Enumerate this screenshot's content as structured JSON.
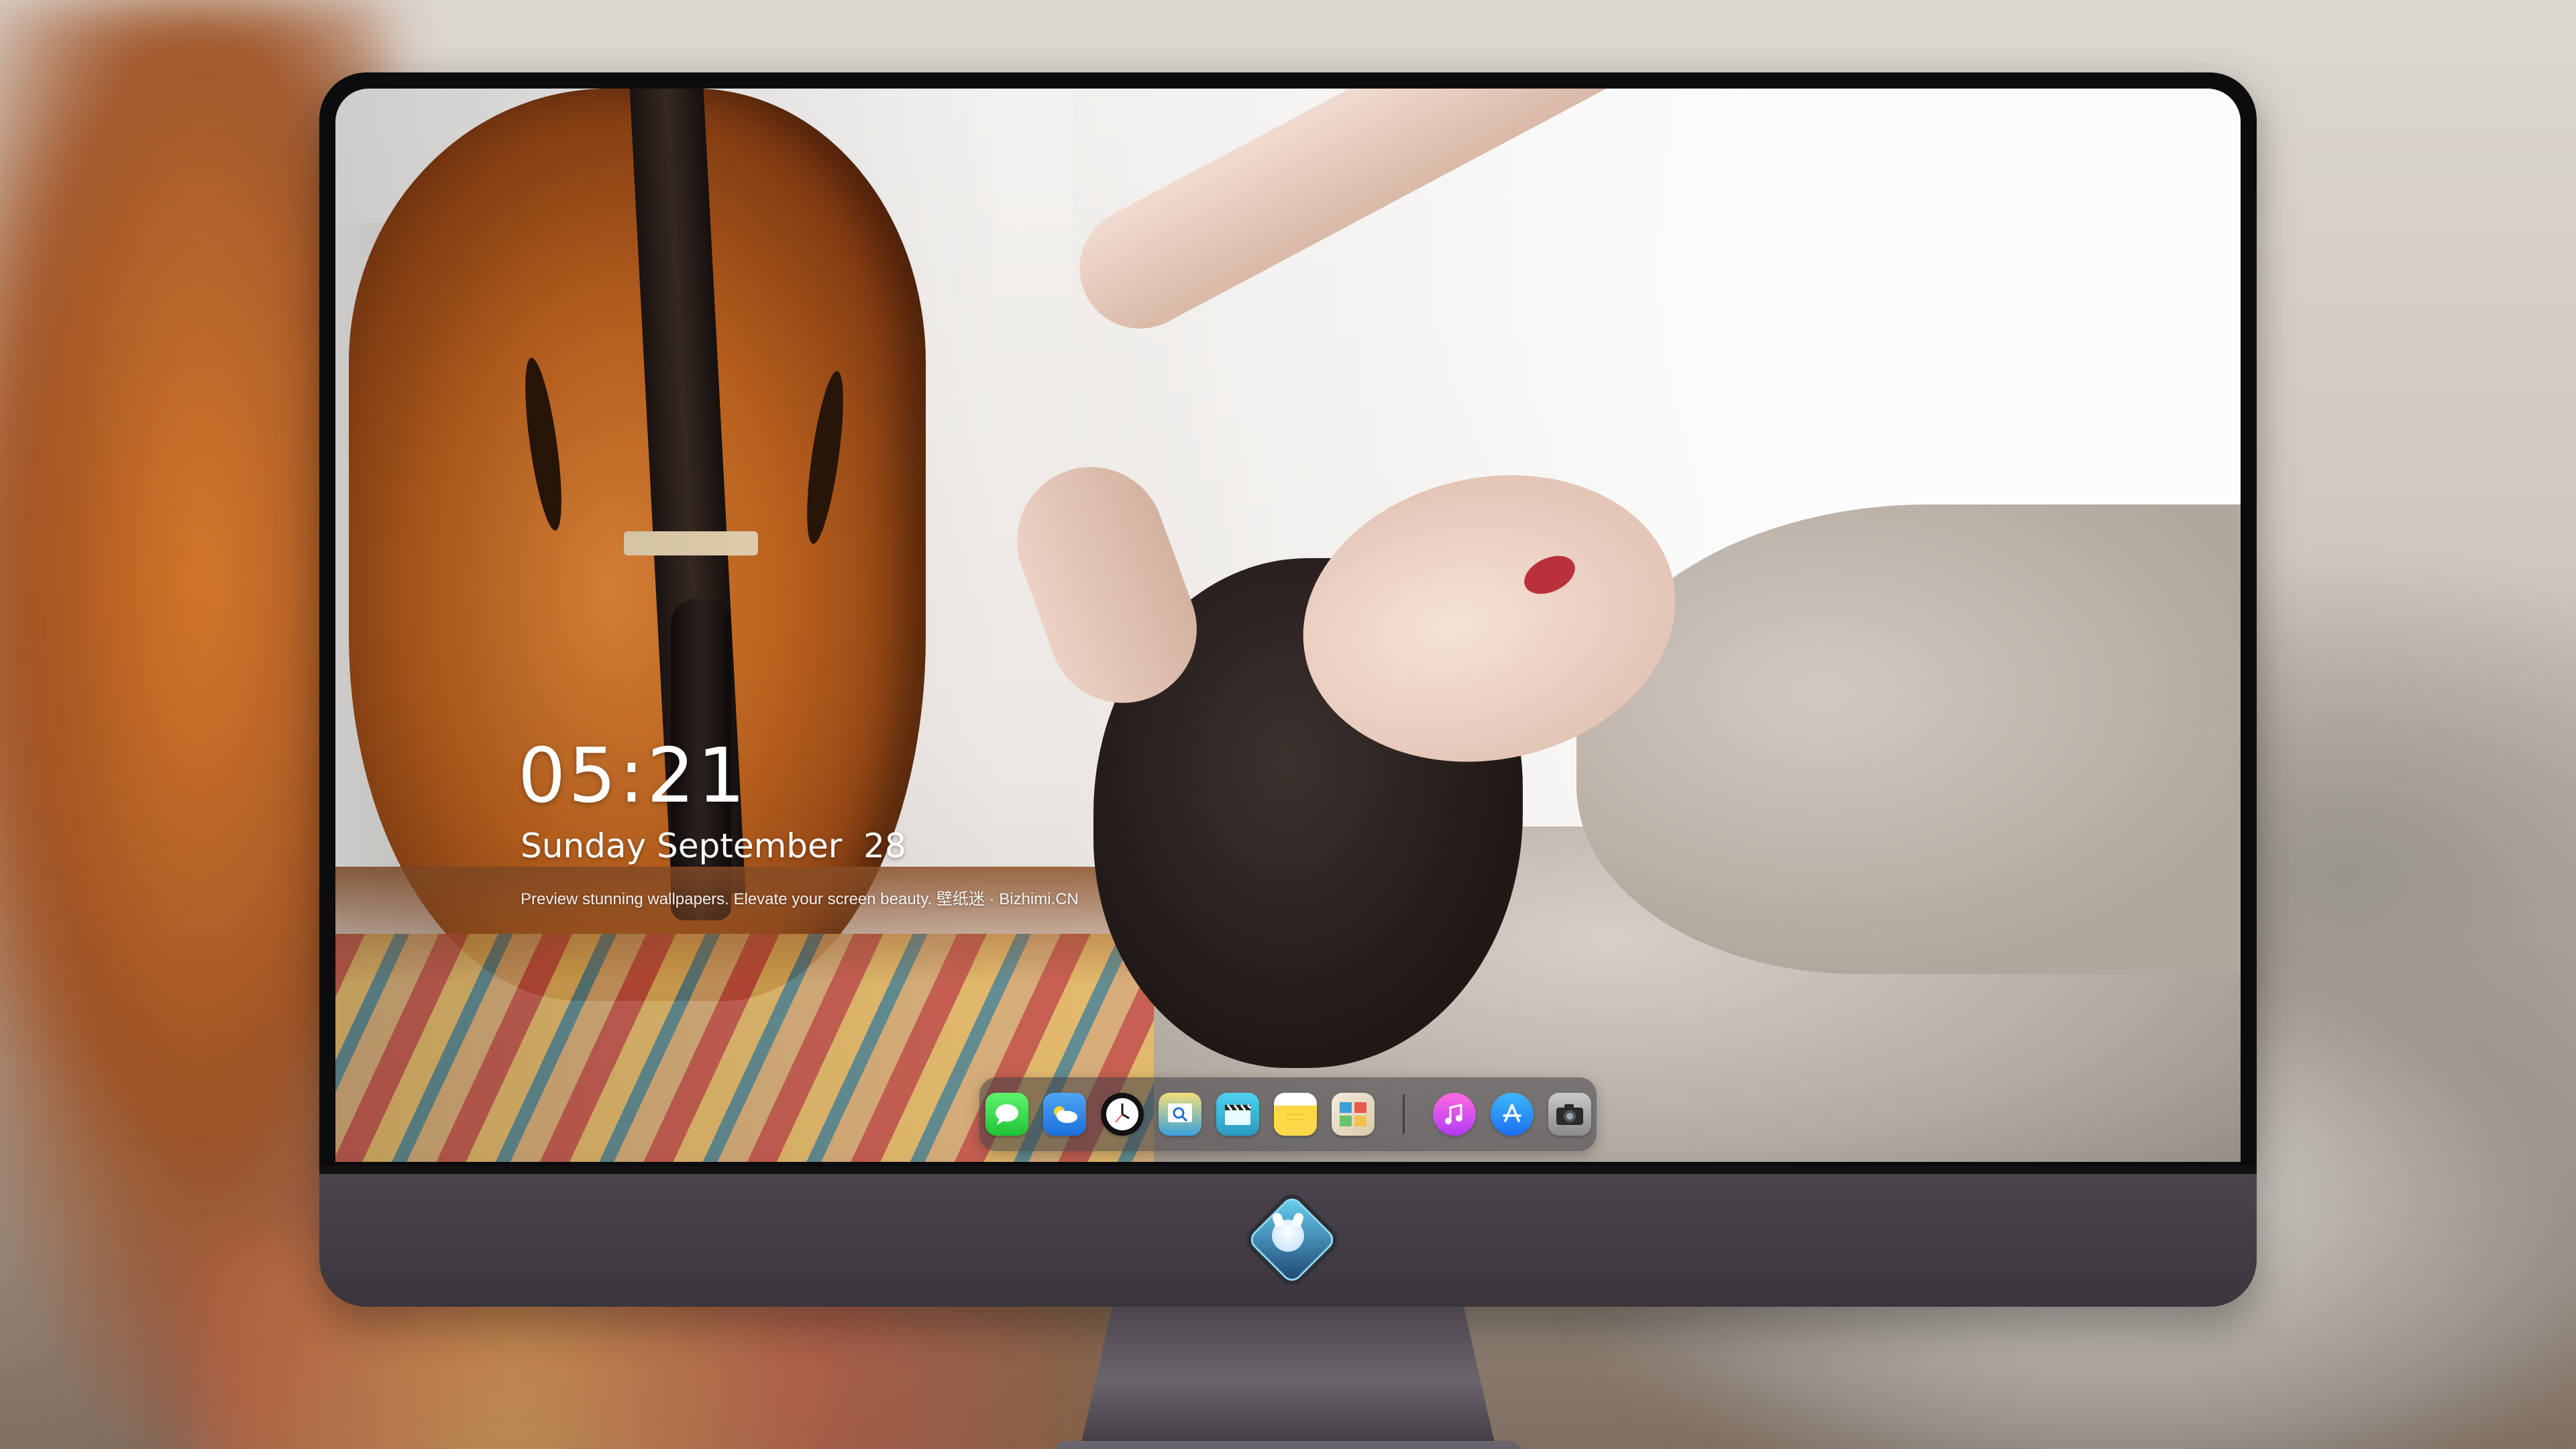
{
  "lockscreen": {
    "time": "05:21",
    "date": "Sunday September  28",
    "tagline": "Preview stunning wallpapers. Elevate your screen beauty. 壁纸迷 · Bizhimi.CN"
  },
  "dock": {
    "apps": [
      {
        "name": "Messages",
        "icon": "messages-icon",
        "glyph": "💬"
      },
      {
        "name": "Weather",
        "icon": "weather-icon",
        "glyph": "☁"
      },
      {
        "name": "Clock",
        "icon": "clock-icon",
        "glyph": "🕓"
      },
      {
        "name": "Preview",
        "icon": "preview-icon",
        "glyph": "🔍"
      },
      {
        "name": "Clips",
        "icon": "clapperboard-icon",
        "glyph": "🎬"
      },
      {
        "name": "Notes",
        "icon": "notes-icon",
        "glyph": ""
      },
      {
        "name": "Photos",
        "icon": "photo-collage-icon",
        "glyph": "▦"
      },
      {
        "name": "Music",
        "icon": "music-icon",
        "glyph": "♫"
      },
      {
        "name": "App Store",
        "icon": "app-store-icon",
        "glyph": "Ⓐ"
      },
      {
        "name": "Camera",
        "icon": "camera-icon",
        "glyph": "📷"
      }
    ]
  },
  "colors": {
    "bezel": "#0c0c0e",
    "chin": "#3f3a41",
    "dock_bg": "rgba(60,60,66,0.55)",
    "text": "#ffffff"
  },
  "logo": {
    "icon": "mascot-logo-icon"
  }
}
